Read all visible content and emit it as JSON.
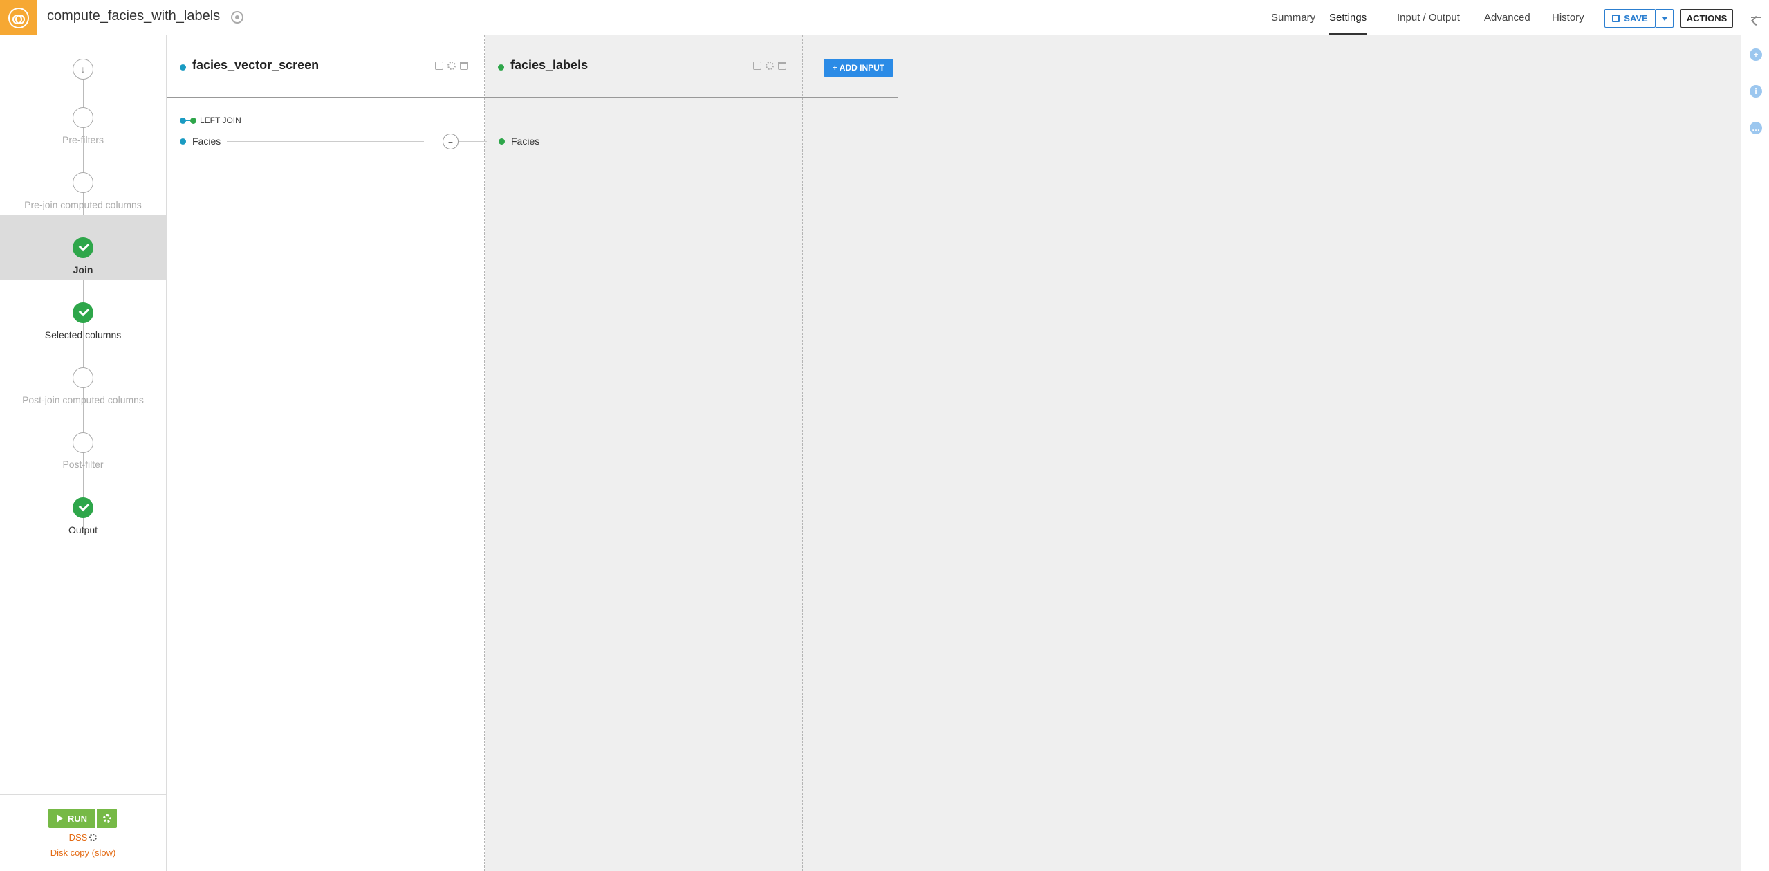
{
  "header": {
    "recipe_title": "compute_facies_with_labels",
    "tabs": [
      {
        "label": "Summary",
        "active": false
      },
      {
        "label": "Settings",
        "active": true
      },
      {
        "label": "Input / Output",
        "active": false
      },
      {
        "label": "Advanced",
        "active": false
      },
      {
        "label": "History",
        "active": false
      }
    ],
    "save_label": "SAVE",
    "actions_label": "ACTIONS"
  },
  "sidebar": {
    "input_step_glyph": "↓",
    "steps": [
      {
        "label": "Pre-filters",
        "state": "empty"
      },
      {
        "label": "Pre-join computed columns",
        "state": "empty"
      },
      {
        "label": "Join",
        "state": "done",
        "active": true
      },
      {
        "label": "Selected columns",
        "state": "done"
      },
      {
        "label": "Post-join computed columns",
        "state": "empty"
      },
      {
        "label": "Post-filter",
        "state": "empty"
      },
      {
        "label": "Output",
        "state": "done"
      }
    ],
    "run_label": "RUN",
    "engine_label": "DSS",
    "engine_mode": "Disk copy (slow)"
  },
  "join": {
    "left_dataset": {
      "name": "facies_vector_screen",
      "color": "#1a9bc2"
    },
    "right_dataset": {
      "name": "facies_labels",
      "color": "#2ea64a"
    },
    "add_input_label": "+ ADD INPUT",
    "join_type_label": "LEFT JOIN",
    "condition": {
      "left_column": "Facies",
      "operator": "=",
      "right_column": "Facies"
    }
  },
  "colors": {
    "accent_blue": "#2b8be6",
    "run_green": "#76b946",
    "done_green": "#2ea64a",
    "logo_orange": "#f6a833",
    "engine_orange": "#e46b14"
  }
}
